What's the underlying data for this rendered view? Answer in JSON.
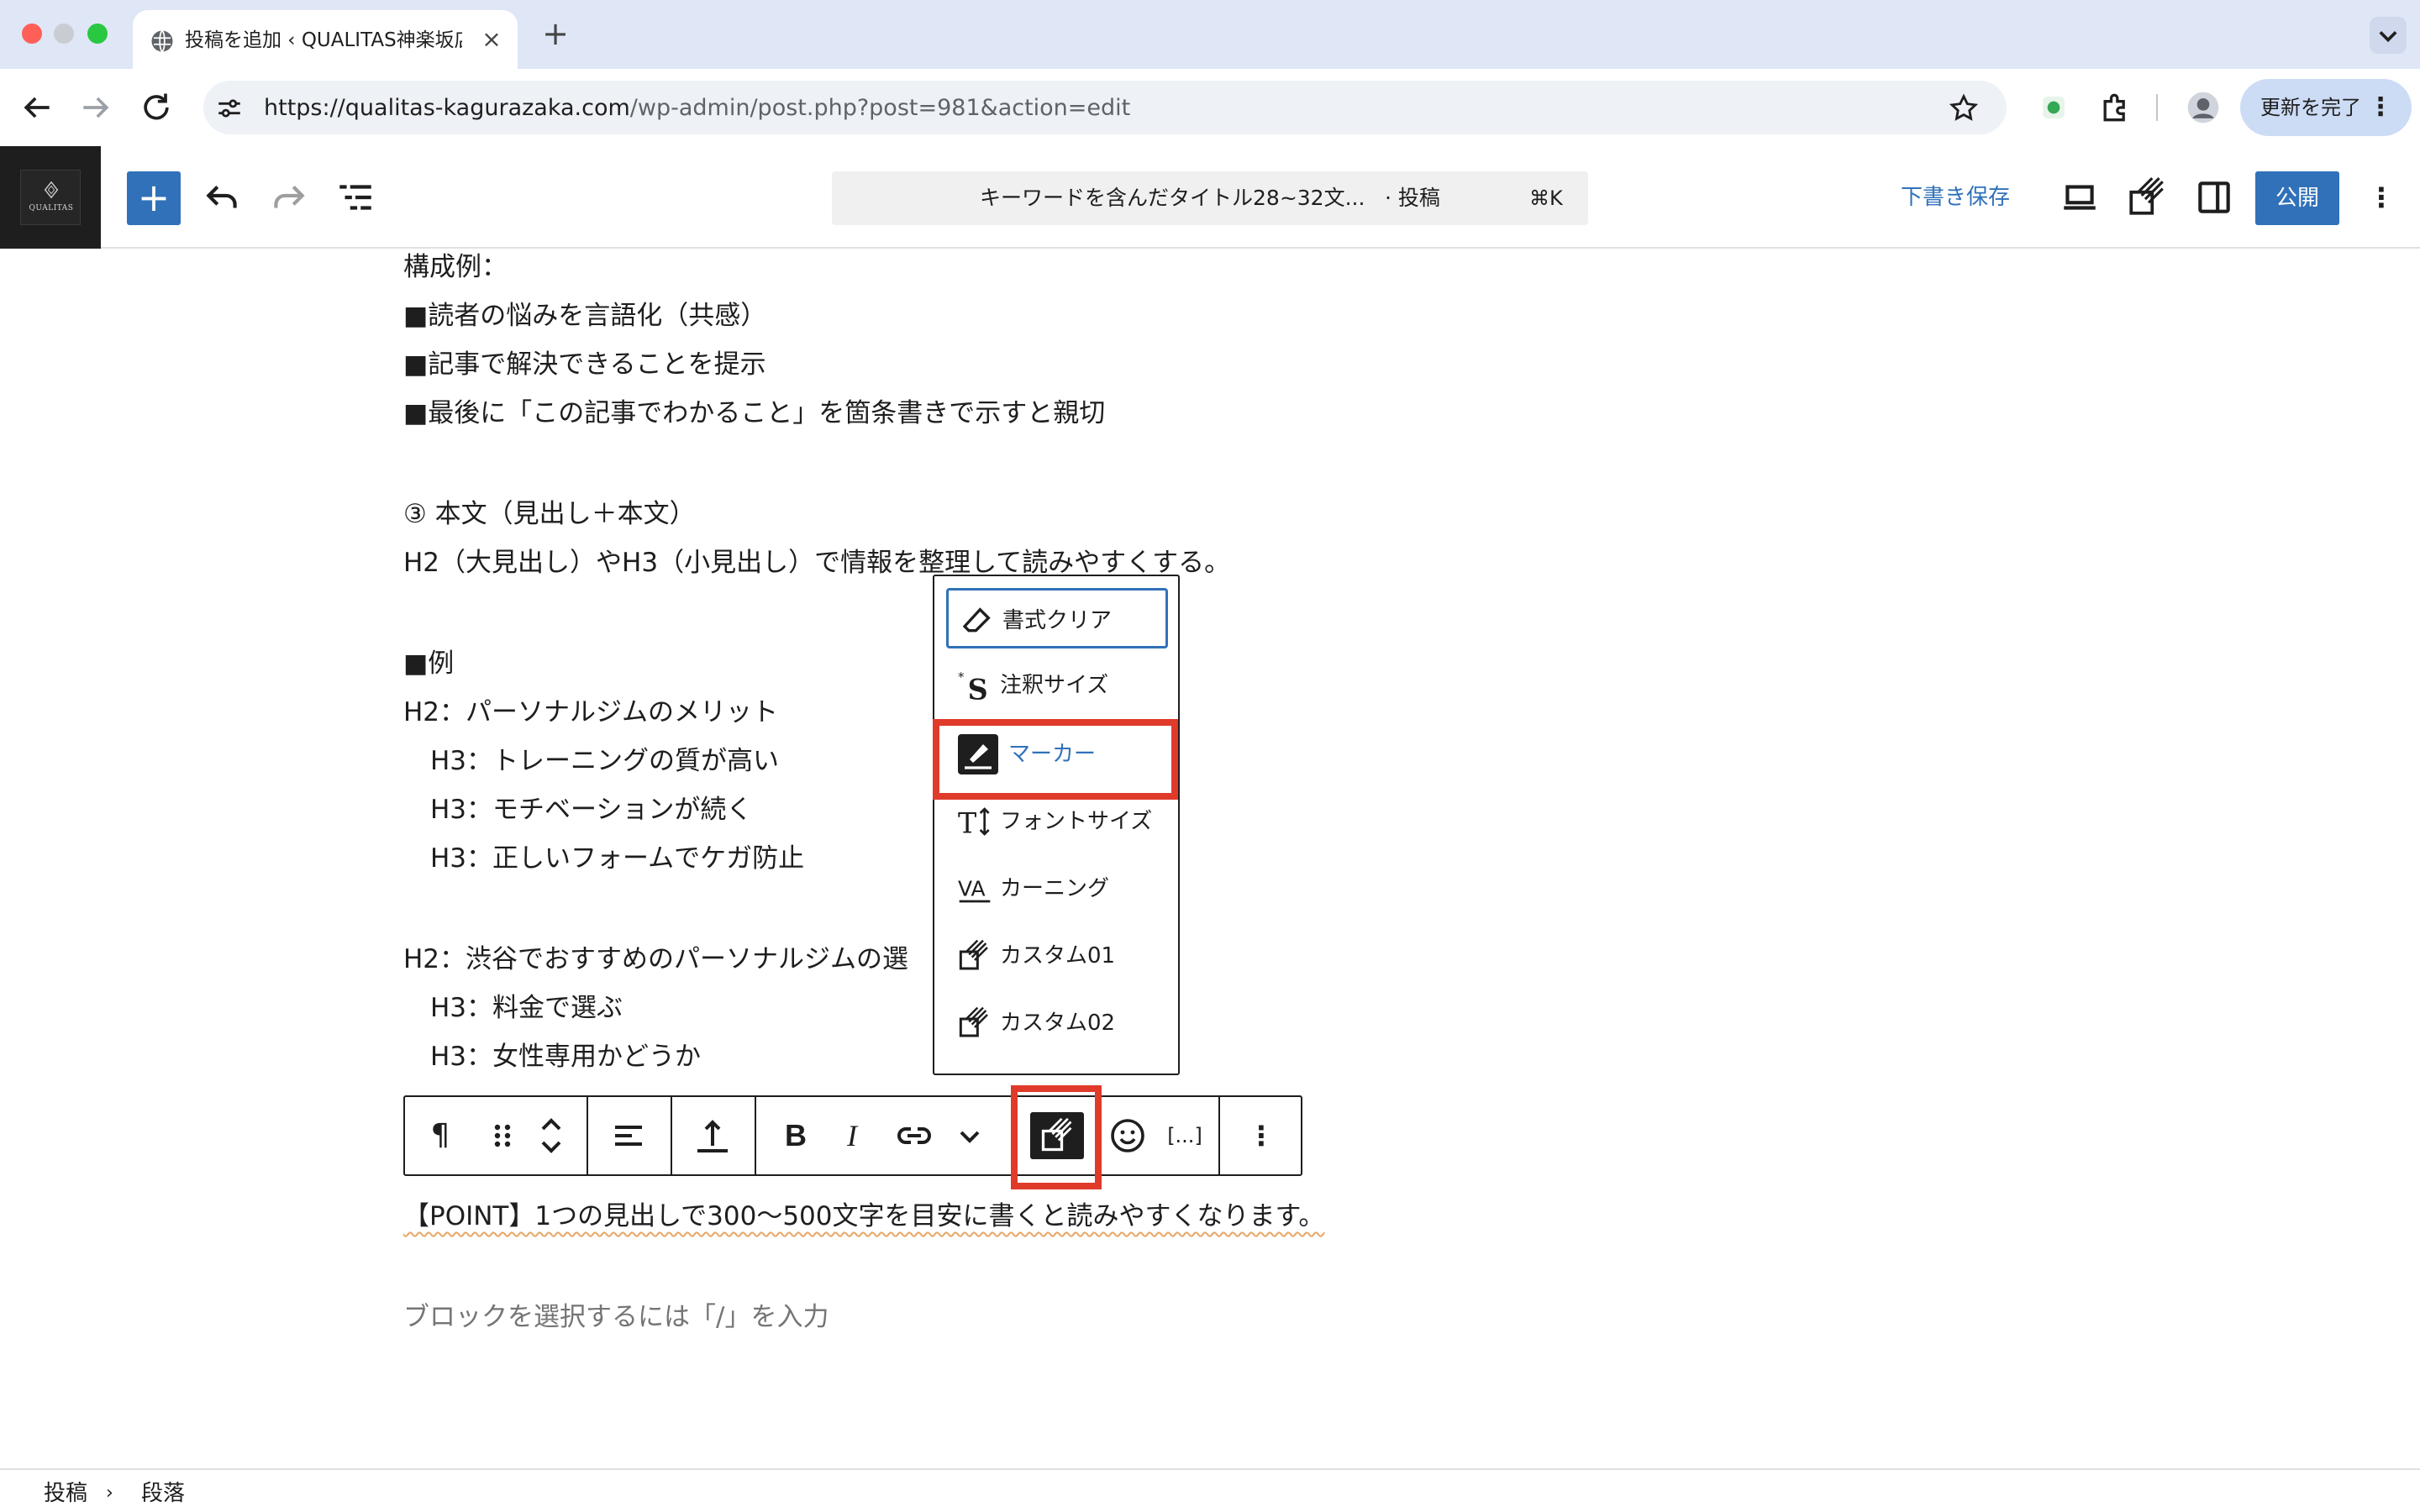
{
  "browser": {
    "tab_title": "投稿を追加 ‹ QUALITAS神楽坂店",
    "tab_close": "×",
    "new_tab": "+",
    "url_host": "https://qualitas-kagurazaka.com",
    "url_path": "/wp-admin/post.php?post=981&action=edit",
    "update_button": "更新を完了",
    "kebab": "⋮"
  },
  "editor_header": {
    "logo_text": "QUALITAS",
    "add_block": "+",
    "doc_title": "キーワードを含んだタイトル28~32文...",
    "doc_type": "· 投稿",
    "shortcut": "⌘K",
    "save_draft": "下書き保存",
    "publish": "公開",
    "more": "⋮"
  },
  "content": {
    "lines": [
      "構成例：",
      "■読者の悩みを言語化（共感）",
      "■記事で解決できることを提示",
      "■最後に「この記事でわかること」を箇条書きで示すと親切",
      "③ 本文（見出し＋本文）",
      "H2（大見出し）やH3（小見出し）で情報を整理して読みやすくする。",
      "■例",
      "H2：パーソナルジムのメリット",
      "H3：トレーニングの質が高い",
      "H3：モチベーションが続く",
      "H3：正しいフォームでケガ防止",
      "H2：渋谷でおすすめのパーソナルジムの選",
      "H3：料金で選ぶ",
      "H3：女性専用かどうか",
      "【POINT】1つの見出しで300〜500文字を目安に書くと読みやすくなります。"
    ],
    "placeholder": "ブロックを選択するには「/」を入力"
  },
  "block_toolbar": {
    "paragraph": "¶",
    "bold": "B",
    "italic": "I",
    "shortcode": "[...]",
    "more": "⋮"
  },
  "format_menu": {
    "items": [
      {
        "label": "書式クリア",
        "icon": "eraser-icon"
      },
      {
        "label": "注釈サイズ",
        "icon": "annotation-size-icon"
      },
      {
        "label": "マーカー",
        "icon": "marker-pen-icon"
      },
      {
        "label": "フォントサイズ",
        "icon": "font-size-icon"
      },
      {
        "label": "カーニング",
        "icon": "kerning-icon"
      },
      {
        "label": "カスタム01",
        "icon": "custom-format-icon"
      },
      {
        "label": "カスタム02",
        "icon": "custom-format-icon"
      }
    ],
    "focused_item": "書式クリア",
    "highlighted_item": "マーカー"
  },
  "breadcrumb": {
    "items": [
      "投稿",
      "段落"
    ],
    "separator": "›"
  },
  "colors": {
    "accent": "#3071b9",
    "annotation_red": "#e03a2b",
    "logo_bg": "#1e1e1e"
  }
}
